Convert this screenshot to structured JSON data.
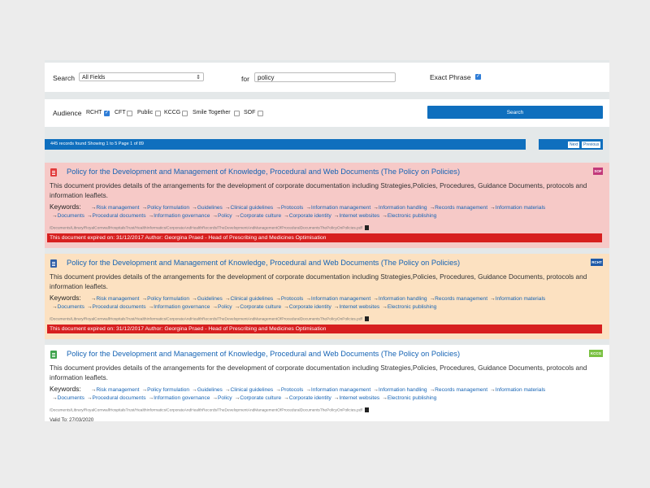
{
  "search": {
    "label": "Search",
    "field_select": "All Fields",
    "for_label": "for",
    "query": "policy",
    "exact_phrase_label": "Exact Phrase",
    "exact_phrase_checked": true
  },
  "audience": {
    "label": "Audience",
    "options": [
      {
        "label": "RCHT",
        "checked": true
      },
      {
        "label": "CFT",
        "checked": false
      },
      {
        "label": "Public",
        "checked": false
      },
      {
        "label": "KCCG",
        "checked": false
      },
      {
        "label": "Smile Together",
        "checked": false
      },
      {
        "label": "SOF",
        "checked": false
      }
    ],
    "search_button": "Search"
  },
  "status": {
    "text": "445 records found Showing 1 to 5 Page 1 of 89",
    "next": "Next",
    "previous": "Previous"
  },
  "colors": {
    "primary": "#0f6fbe",
    "link": "#1563b4",
    "expired": "#d71f1f"
  },
  "keywords_label": "Keywords:",
  "results": [
    {
      "title": "Policy for the Development and Management of Knowledge, Procedural and Web Documents (The Policy on Policies)",
      "badge": "SOF",
      "badge_color": "#c2387a",
      "icon_color": "#e23b3b",
      "icon": "document-icon",
      "description": "This document provides details of the arrangements for the development of corporate documentation including Strategies,Policies, Procedures, Guidance Documents, protocols and information leaflets.",
      "keywords_line1": [
        "Risk management",
        "Policy formulation",
        "Guidelines",
        "Clinical guidelines",
        "Protocols",
        "Information management",
        "Information handling",
        "Records management",
        "Information materials"
      ],
      "keywords_line2": [
        "Documents",
        "Procedural documents",
        "Information governance",
        "Policy",
        "Corporate culture",
        "Corporate identity",
        "Internet websites",
        "Electronic publishing"
      ],
      "path": "/Documents/Library/RoyalCornwallHospitalsTrust/HealthInformatics/CorporateAndHealthRecords/TheDevelopmentAndManagementOfProceduralDocumentsThePolicyOnPolicies.pdf",
      "note": "This document expired on: 31/12/2017 Author: Georgina Praed - Head of Prescribing and Medicines Optimisation"
    },
    {
      "title": "Policy for the Development and Management of Knowledge, Procedural and Web Documents (The Policy on Policies)",
      "badge": "RCHT",
      "badge_color": "#1f5aa8",
      "icon_color": "#2f5ea8",
      "icon": "document-icon",
      "description": "This document provides details of the arrangements for the development of corporate documentation including Strategies,Policies, Procedures, Guidance Documents, protocols and information leaflets.",
      "keywords_line1": [
        "Risk management",
        "Policy formulation",
        "Guidelines",
        "Clinical guidelines",
        "Protocols",
        "Information management",
        "Information handling",
        "Records management",
        "Information materials"
      ],
      "keywords_line2": [
        "Documents",
        "Procedural documents",
        "Information governance",
        "Policy",
        "Corporate culture",
        "Corporate identity",
        "Internet websites",
        "Electronic publishing"
      ],
      "path": "/Documents/Library/RoyalCornwallHospitalsTrust/HealthInformatics/CorporateAndHealthRecords/TheDevelopmentAndManagementOfProceduralDocumentsThePolicyOnPolicies.pdf",
      "note": "This document expired on: 31/12/2017 Author: Georgina Praed - Head of Prescribing and Medicines Optimisation"
    },
    {
      "title": "Policy for the Development and Management of Knowledge, Procedural and Web Documents (The Policy on Policies)",
      "badge": "KCCG",
      "badge_color": "#7ac142",
      "icon_color": "#3fa34d",
      "icon": "document-icon",
      "description": "This document provides details of the arrangements for the development of corporate documentation including Strategies,Policies, Procedures, Guidance Documents, protocols and information leaflets.",
      "keywords_line1": [
        "Risk management",
        "Policy formulation",
        "Guidelines",
        "Clinical guidelines",
        "Protocols",
        "Information management",
        "Information handling",
        "Records management",
        "Information materials"
      ],
      "keywords_line2": [
        "Documents",
        "Procedural documents",
        "Information governance",
        "Policy",
        "Corporate culture",
        "Corporate identity",
        "Internet websites",
        "Electronic publishing"
      ],
      "path": "/Documents/Library/RoyalCornwallHospitalsTrust/HealthInformatics/CorporateAndHealthRecords/TheDevelopmentAndManagementOfProceduralDocumentsThePolicyOnPolicies.pdf",
      "note": "Valid To: 27/03/2020"
    }
  ]
}
